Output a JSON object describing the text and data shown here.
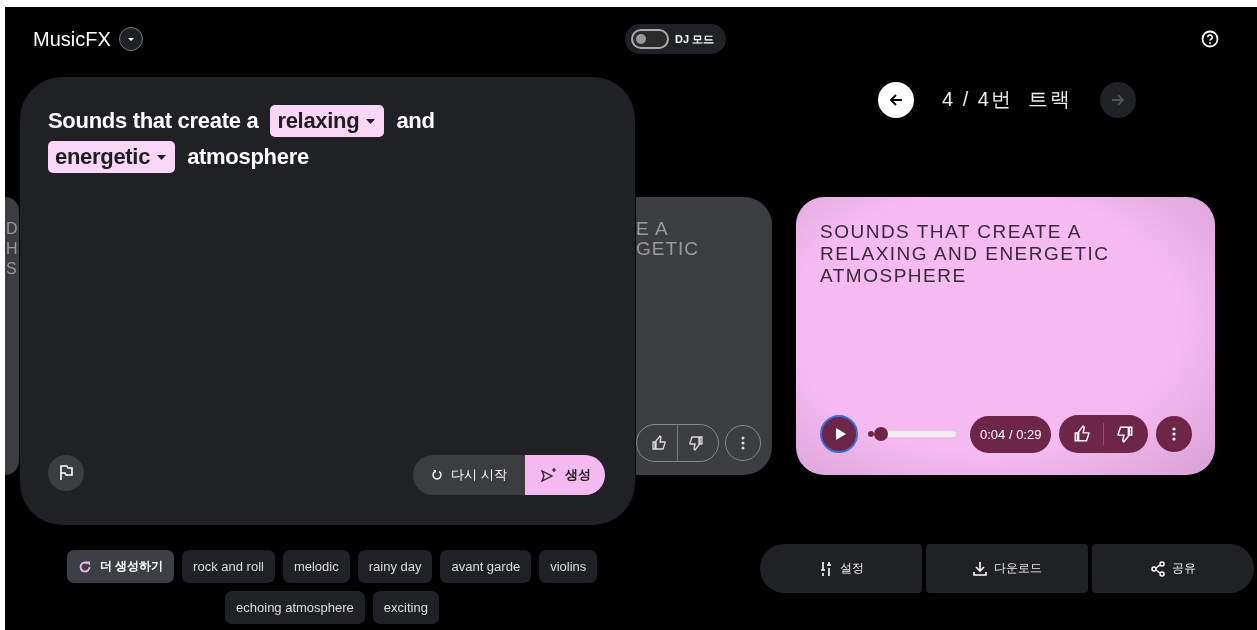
{
  "app": {
    "title": "MusicFX"
  },
  "dj_mode": {
    "label": "DJ 모드",
    "on": false
  },
  "prompt": {
    "segments": [
      {
        "kind": "text",
        "text": "Sounds that create a"
      },
      {
        "kind": "chip",
        "text": "relaxing"
      },
      {
        "kind": "text",
        "text": "and"
      },
      {
        "kind": "chip",
        "text": "energetic"
      },
      {
        "kind": "text",
        "text": "atmosphere"
      }
    ],
    "restart_label": "다시 시작",
    "generate_label": "생성"
  },
  "suggestions": {
    "more_label": "더 생성하기",
    "chips": [
      "rock and roll",
      "melodic",
      "rainy day",
      "avant garde",
      "violins",
      "echoing atmosphere",
      "exciting"
    ]
  },
  "track_nav": {
    "label": "4 / 4번  트랙",
    "prev_disabled": false,
    "next_disabled": true
  },
  "cards": [
    {
      "kind": "stub",
      "lines": [
        "D",
        "H",
        "S"
      ]
    },
    {
      "kind": "side",
      "lines": [
        "E A",
        "GETIC"
      ]
    },
    {
      "kind": "main",
      "lines": [
        "SOUNDS THAT CREATE A",
        "RELAXING AND ENERGETIC",
        "ATMOSPHERE"
      ],
      "level": 0.15,
      "time": "0:04 / 0:29"
    }
  ],
  "actions": [
    {
      "kind": "settings",
      "label": "설정"
    },
    {
      "kind": "download",
      "label": "다운로드"
    },
    {
      "kind": "share",
      "label": "공유"
    }
  ]
}
